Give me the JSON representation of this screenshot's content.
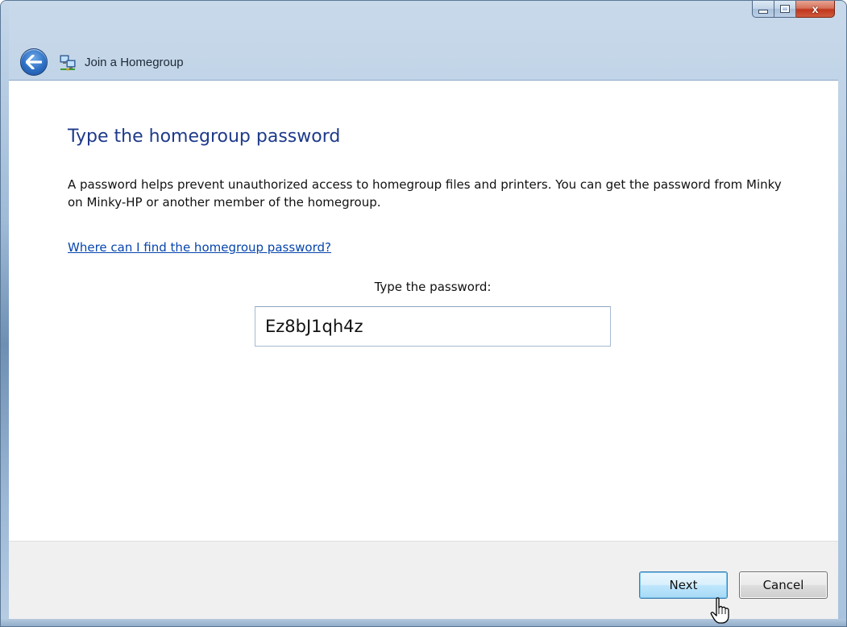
{
  "window": {
    "title": "Join a Homegroup",
    "icons": {
      "back": "back-arrow-icon",
      "app": "homegroup-icon",
      "minimize": "minimize-icon",
      "maximize": "maximize-icon",
      "close": "close-icon"
    },
    "close_symbol": "x"
  },
  "page": {
    "heading": "Type the homegroup password",
    "description": "A password helps prevent unauthorized access to homegroup files and printers. You can get the password from Minky on Minky-HP or another member of the homegroup.",
    "help_link": "Where can I find the homegroup password?",
    "password_label": "Type the password:",
    "password_value": "Ez8bJ1qh4z"
  },
  "footer": {
    "next_label": "Next",
    "cancel_label": "Cancel"
  },
  "colors": {
    "heading": "#1e3a8a",
    "link": "#0645ad",
    "close_button": "#c0371c"
  }
}
